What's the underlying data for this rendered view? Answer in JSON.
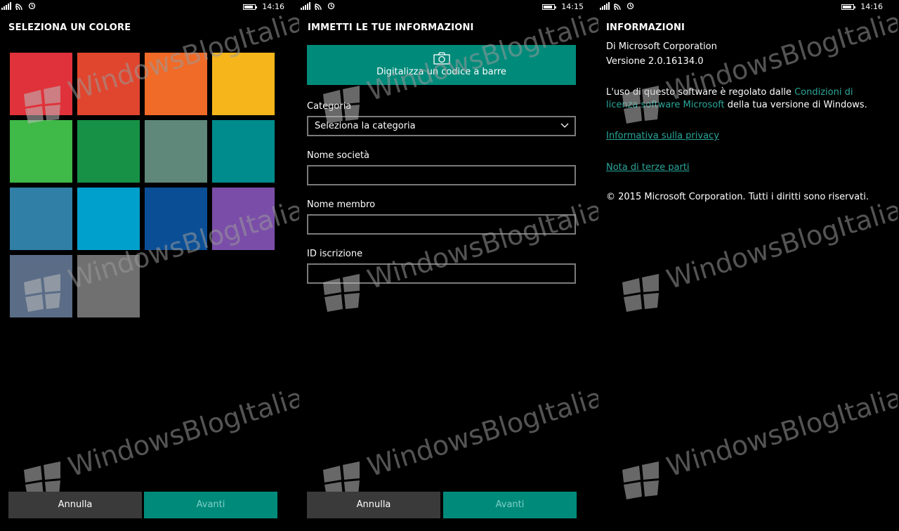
{
  "watermark": "WindowsBlogItalia",
  "panel1": {
    "time": "14:16",
    "title": "SELEZIONA UN COLORE",
    "colors": [
      "#e0323a",
      "#e0462e",
      "#f06a28",
      "#f7b51c",
      "#3fb948",
      "#169146",
      "#5f877a",
      "#008c8c",
      "#2f7fa6",
      "#00a0cc",
      "#0a4f96",
      "#7a4ea8",
      "#5a6c86",
      "#707070"
    ],
    "cancel_label": "Annulla",
    "next_label": "Avanti"
  },
  "panel2": {
    "time": "14:15",
    "title": "IMMETTI LE TUE INFORMAZIONI",
    "scan_label": "Digitalizza un codice a barre",
    "category_label": "Categoria",
    "category_value": "Seleziona la categoria",
    "company_label": "Nome società",
    "company_value": "",
    "member_label": "Nome membro",
    "member_value": "",
    "id_label": "ID iscrizione",
    "id_value": "",
    "cancel_label": "Annulla",
    "next_label": "Avanti"
  },
  "panel3": {
    "time": "14:16",
    "title": "INFORMAZIONI",
    "publisher": "Di Microsoft Corporation",
    "version": "Versione 2.0.16134.0",
    "license_prefix": "L'uso di questo software è regolato dalle",
    "license_link": "Condizioni di licenza software Microsoft",
    "license_suffix": "della tua versione di Windows.",
    "privacy_link": "Informativa sulla privacy",
    "third_party_link": "Nota di terze parti",
    "copyright": "© 2015 Microsoft Corporation. Tutti i diritti sono riservati."
  }
}
